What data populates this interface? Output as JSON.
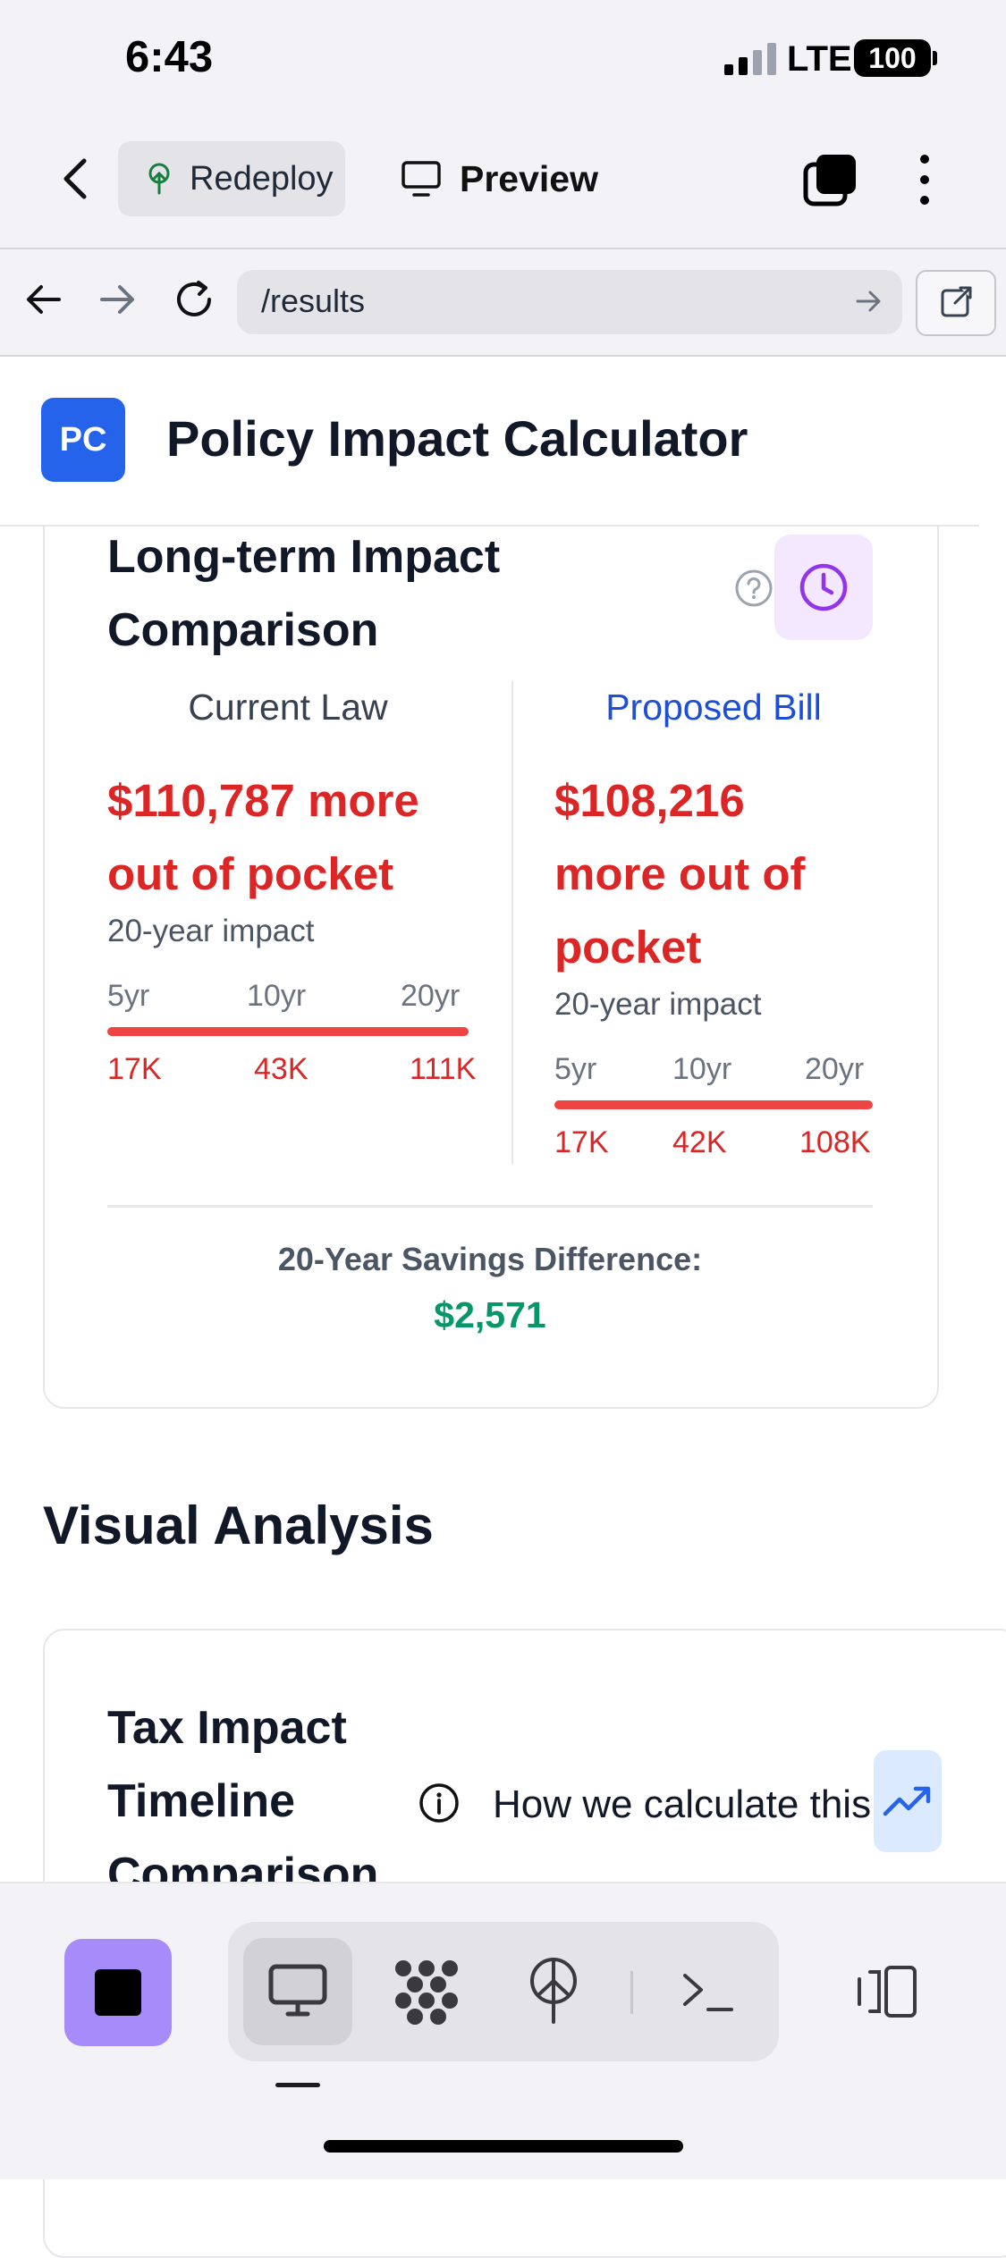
{
  "status_bar": {
    "time": "6:43",
    "network": "LTE",
    "battery": "100"
  },
  "app_bar": {
    "redeploy_label": "Redeploy",
    "preview_label": "Preview"
  },
  "url_bar": {
    "url": "/results"
  },
  "app_header": {
    "logo_text": "PC",
    "title": "Policy Impact Calculator"
  },
  "long_term": {
    "title": "Long-term Impact Comparison",
    "current": {
      "heading": "Current Law",
      "amount": "$110,787 more out of pocket",
      "sub": "20-year impact",
      "ticks": [
        "5yr",
        "10yr",
        "20yr"
      ],
      "values": [
        "17K",
        "43K",
        "111K"
      ]
    },
    "proposed": {
      "heading": "Proposed Bill",
      "amount": "$108,216 more out of pocket",
      "sub": "20-year impact",
      "ticks": [
        "5yr",
        "10yr",
        "20yr"
      ],
      "values": [
        "17K",
        "42K",
        "108K"
      ]
    },
    "difference_label": "20-Year Savings Difference:",
    "difference_value": "$2,571"
  },
  "visual_analysis": {
    "section_title": "Visual Analysis",
    "card_title": "Tax Impact Timeline Comparison",
    "how_calc": "How we calculate this"
  },
  "colors": {
    "accent_blue": "#2563eb",
    "negative_red": "#dc2626",
    "positive_green": "#059669",
    "stop_purple": "#a78bfa"
  }
}
